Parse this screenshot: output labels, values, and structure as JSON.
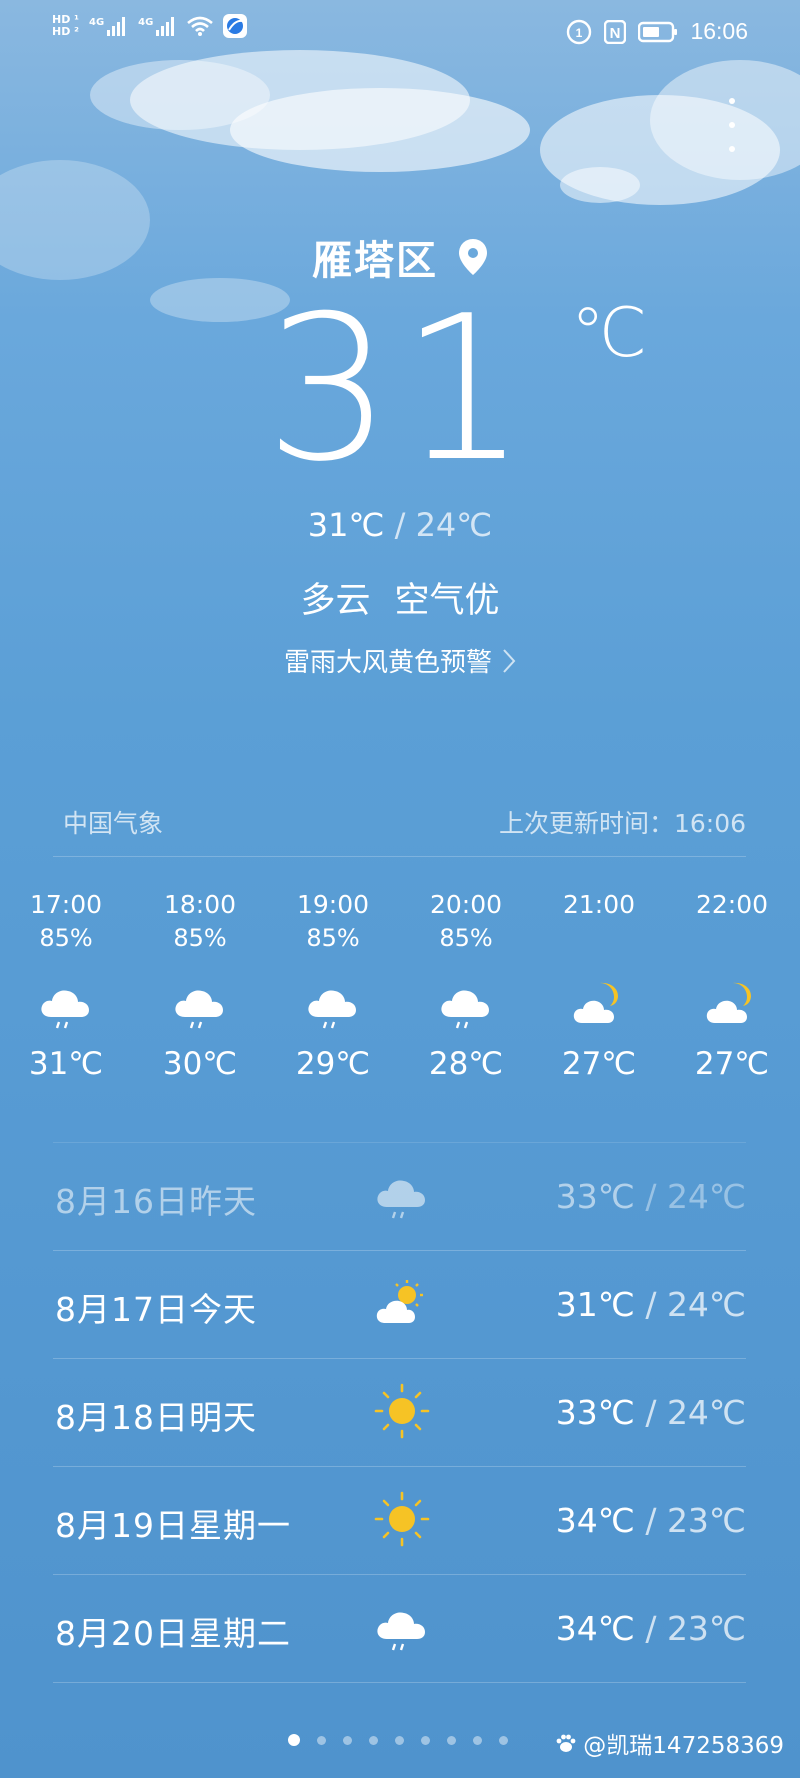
{
  "status_bar": {
    "sim1": "HD",
    "sim2": "HD",
    "net1": "4G",
    "net2": "4G",
    "time": "16:06"
  },
  "location": {
    "name": "雁塔区"
  },
  "current": {
    "temp": "31",
    "unit": "℃",
    "high": "31℃",
    "separator": " / ",
    "low": "24℃",
    "condition": "多云",
    "air": "空气优",
    "alert": "雷雨大风黄色预警"
  },
  "source": {
    "provider": "中国气象",
    "updated": "上次更新时间：16:06"
  },
  "hourly": [
    {
      "time": "17:00",
      "precip": "85%",
      "icon": "cloud-rain-icon",
      "temp": "31℃"
    },
    {
      "time": "18:00",
      "precip": "85%",
      "icon": "cloud-rain-icon",
      "temp": "30℃"
    },
    {
      "time": "19:00",
      "precip": "85%",
      "icon": "cloud-rain-icon",
      "temp": "29℃"
    },
    {
      "time": "20:00",
      "precip": "85%",
      "icon": "cloud-rain-icon",
      "temp": "28℃"
    },
    {
      "time": "21:00",
      "precip": "",
      "icon": "moon-cloud-icon",
      "temp": "27℃"
    },
    {
      "time": "22:00",
      "precip": "",
      "icon": "moon-cloud-icon",
      "temp": "27℃"
    }
  ],
  "daily": [
    {
      "label": "8月16日昨天",
      "icon": "cloud-rain-icon",
      "high": "33℃",
      "low": "24℃"
    },
    {
      "label": "8月17日今天",
      "icon": "sun-cloud-icon",
      "high": "31℃",
      "low": "24℃"
    },
    {
      "label": "8月18日明天",
      "icon": "sun-icon",
      "high": "33℃",
      "low": "24℃"
    },
    {
      "label": "8月19日星期一",
      "icon": "sun-icon",
      "high": "34℃",
      "low": "23℃"
    },
    {
      "label": "8月20日星期二",
      "icon": "cloud-rain-icon",
      "high": "34℃",
      "low": "23℃"
    }
  ],
  "daily_separator": " / ",
  "pager": {
    "count": 9,
    "active": 0
  },
  "watermark": "@凯瑞147258369",
  "colors": {
    "sky_top": "#8ab8e0",
    "sky_bottom": "#4f93cd",
    "sun": "#f6c325",
    "cloud": "#ffffff"
  }
}
